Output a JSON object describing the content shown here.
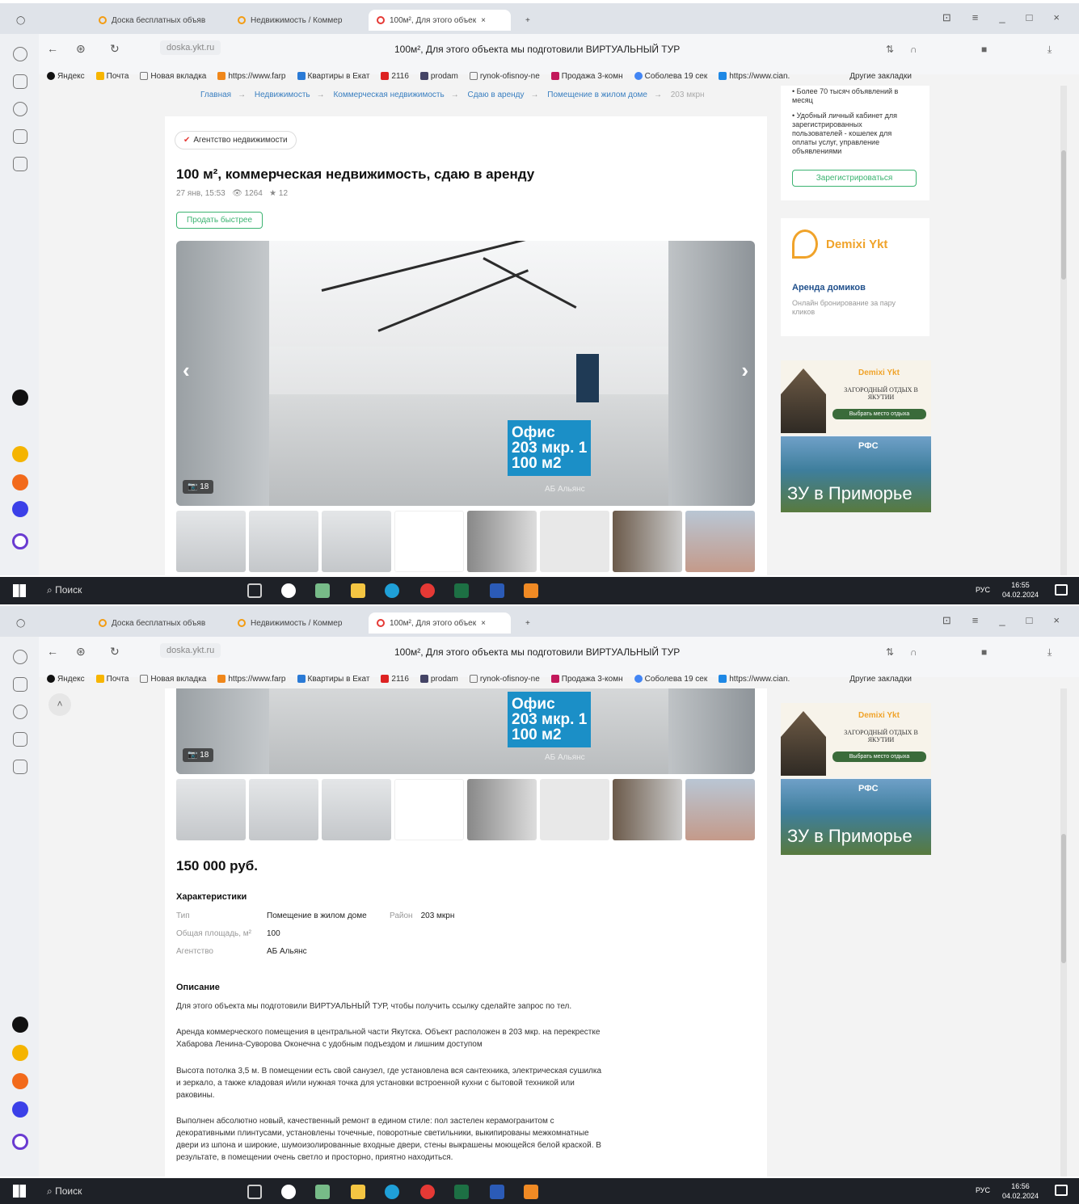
{
  "browser": {
    "tabs": [
      {
        "label": "Доска бесплатных объяв"
      },
      {
        "label": "Недвижимость / Коммер"
      },
      {
        "label": "100м², Для этого объек"
      }
    ],
    "url": "doska.ykt.ru",
    "page_title": "100м², Для этого объекта мы подготовили ВИРТУАЛЬНЫЙ ТУР",
    "bookmarks": [
      "Яндекс",
      "Почта",
      "Новая вкладка",
      "https://www.farp",
      "Квартиры в Екат",
      "2116",
      "prodam",
      "rynok-ofisnoy-ne",
      "Продажа 3-комн",
      "Соболева 19 сек",
      "https://www.cian."
    ],
    "other_bookmarks": "Другие закладки"
  },
  "breadcrumbs": [
    "Главная",
    "Недвижимость",
    "Коммерческая недвижимость",
    "Сдаю в аренду",
    "Помещение в жилом доме",
    "203 мкрн"
  ],
  "listing": {
    "agency_badge": "Агентство недвижимости",
    "title": "100 м², коммерческая недвижимость, сдаю в аренду",
    "date": "27 янв, 15:53",
    "views": "1264",
    "favorites": "12",
    "boost_button": "Продать быстрее",
    "photo_count": "18",
    "photo_label": [
      "Офис",
      "203 мкр. 1",
      "100 м2"
    ],
    "photo_watermark": "АБ Альянс",
    "price": "150 000 руб.",
    "characteristics_title": "Характеристики",
    "characteristics": [
      {
        "key": "Тип",
        "value": "Помещение в жилом доме"
      },
      {
        "key": "Район",
        "value": "203 мкрн"
      },
      {
        "key": "Общая площадь, м²",
        "value": "100"
      },
      {
        "key": "Агентство",
        "value": "АБ Альянс"
      }
    ],
    "description_title": "Описание",
    "description": [
      "Для этого объекта мы подготовили ВИРТУАЛЬНЫЙ ТУР, чтобы получить ссылку сделайте запрос по тел.",
      "Аренда коммерческого помещения в центральной части Якутска. Объект расположен в 203 мкр. на перекрестке Хабарова Ленина-Суворова Оконечна с удобным подъездом и лишним доступом",
      "Высота потолка 3,5 м. В помещении есть свой санузел, где установлена вся сантехника, электрическая сушилка и зеркало, а также кладовая и/или нужная точка для установки встроенной кухни с бытовой техникой или раковины.",
      "Выполнен абсолютно новый, качественный ремонт в едином стиле: пол застелен керамогранитом с декоративными плинтусами, установлены точечные, поворотные светильники, выкипированы межкомнатные двери из шпона и широкие, шумоизолированные входные двери, стены выкрашены моющейся белой краской. В результате, в помещении очень светло и просторно, приятно находиться."
    ]
  },
  "sidebar_right": {
    "bullets": [
      "Более 70 тысяч объявлений в месяц",
      "Удобный личный кабинет для зарегистрированных пользователей - кошелек для оплаты услуг, управление объявлениями"
    ],
    "register_button": "Зарегистрироваться",
    "ad1_brand": "Demixi Ykt",
    "ad1_title": "Аренда домиков",
    "ad1_text": "Онлайн бронирование за пару кликов",
    "ad2_text": "ЗАГОРОДНЫЙ ОТДЫХ В ЯКУТИИ",
    "ad2_button": "Выбрать место отдыха",
    "ad3_text": "ЗУ в Приморье",
    "ad3_brand": "РФС"
  },
  "taskbar": {
    "search": "Поиск",
    "lang": "РУС",
    "time1": "16:55",
    "time2": "16:56",
    "date": "04.02.2024"
  }
}
